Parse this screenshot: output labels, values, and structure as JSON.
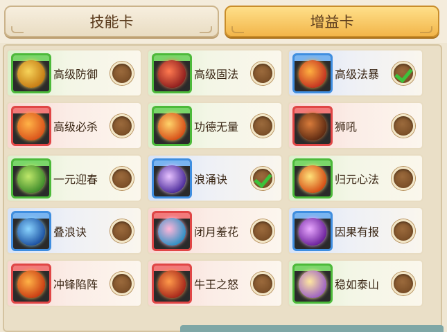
{
  "tabs": [
    {
      "label": "技能卡",
      "active": false
    },
    {
      "label": "增益卡",
      "active": true
    }
  ],
  "cards": [
    {
      "label": "高级防御",
      "frame": "green",
      "checked": false,
      "icon": "gold-shield-icon",
      "orb": [
        "#f7d45a",
        "#c47a12"
      ]
    },
    {
      "label": "高级固法",
      "frame": "green",
      "checked": false,
      "icon": "red-sword-swirl-icon",
      "orb": [
        "#ff7a50",
        "#8e1d1d"
      ]
    },
    {
      "label": "高级法暴",
      "frame": "blue",
      "checked": true,
      "icon": "lightning-orb-icon",
      "orb": [
        "#ffb040",
        "#c23020"
      ]
    },
    {
      "label": "高级必杀",
      "frame": "red",
      "checked": false,
      "icon": "fire-hammer-icon",
      "orb": [
        "#ffb347",
        "#d9521a"
      ]
    },
    {
      "label": "功德无量",
      "frame": "green",
      "checked": false,
      "icon": "flame-lotus-icon",
      "orb": [
        "#ffd36a",
        "#d64c16"
      ]
    },
    {
      "label": "狮吼",
      "frame": "red",
      "checked": false,
      "icon": "lion-roar-icon",
      "orb": [
        "#d87b3a",
        "#5c2a12"
      ]
    },
    {
      "label": "一元迎春",
      "frame": "green",
      "checked": false,
      "icon": "sprout-icon",
      "orb": [
        "#bfe86a",
        "#3d8a2a"
      ]
    },
    {
      "label": "浪涌诀",
      "frame": "blue",
      "checked": true,
      "icon": "purple-vortex-icon",
      "orb": [
        "#e7c2ff",
        "#4a2a9a"
      ]
    },
    {
      "label": "归元心法",
      "frame": "green",
      "checked": false,
      "icon": "sun-burst-icon",
      "orb": [
        "#ffe27a",
        "#d44a12"
      ]
    },
    {
      "label": "叠浪诀",
      "frame": "blue",
      "checked": false,
      "icon": "water-dragon-icon",
      "orb": [
        "#8ad4ff",
        "#1a4fa0"
      ]
    },
    {
      "label": "闭月羞花",
      "frame": "red",
      "checked": false,
      "icon": "pink-flower-icon",
      "orb": [
        "#ffb6d9",
        "#2a8fc4"
      ]
    },
    {
      "label": "因果有报",
      "frame": "blue",
      "checked": false,
      "icon": "purple-spiral-icon",
      "orb": [
        "#e9a8ff",
        "#6a1f9a"
      ]
    },
    {
      "label": "冲锋陷阵",
      "frame": "red",
      "checked": false,
      "icon": "fire-charge-icon",
      "orb": [
        "#ffb347",
        "#c83a12"
      ]
    },
    {
      "label": "牛王之怒",
      "frame": "red",
      "checked": false,
      "icon": "bull-rage-icon",
      "orb": [
        "#ff9a4a",
        "#a5251a"
      ]
    },
    {
      "label": "稳如泰山",
      "frame": "green",
      "checked": false,
      "icon": "golden-mountain-icon",
      "orb": [
        "#ffe7a0",
        "#9a5ec4"
      ]
    }
  ]
}
